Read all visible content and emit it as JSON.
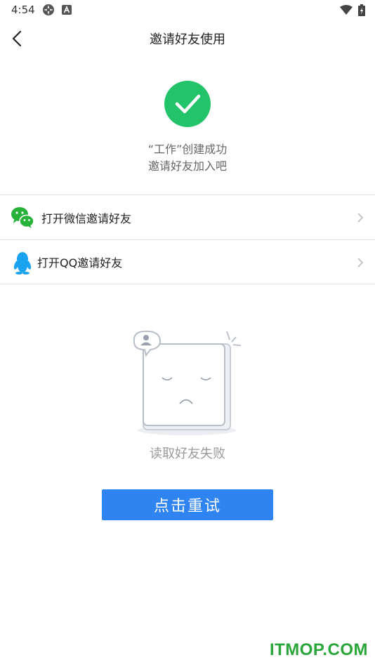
{
  "status_bar": {
    "time": "4:54"
  },
  "header": {
    "title": "邀请好友使用"
  },
  "success": {
    "line1": "“工作”创建成功",
    "line2": "邀请好友加入吧"
  },
  "invite_options": [
    {
      "label": "打开微信邀请好友",
      "icon": "wechat-icon"
    },
    {
      "label": "打开QQ邀请好友",
      "icon": "qq-icon"
    }
  ],
  "empty_state": {
    "message": "读取好友失败",
    "retry_label": "点击重试"
  },
  "watermark": "ITMOP.COM",
  "colors": {
    "success": "#23c36a",
    "button": "#2f84f2",
    "wechat": "#27b33a",
    "qq": "#1aa3f0"
  }
}
